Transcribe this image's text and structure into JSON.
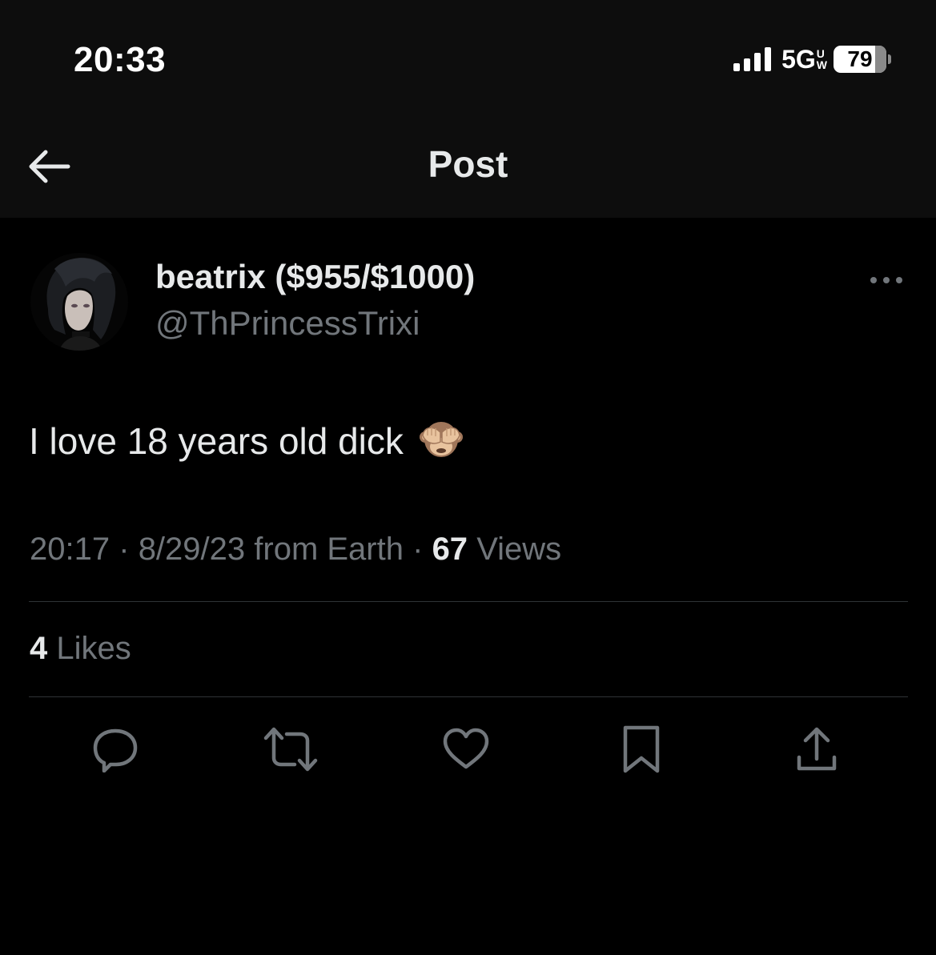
{
  "status_bar": {
    "time": "20:33",
    "network": "5G",
    "network_sub_top": "U",
    "network_sub_bottom": "W",
    "battery_level": "79",
    "battery_fraction": 0.79
  },
  "header": {
    "title": "Post",
    "back_icon": "arrow-left-icon"
  },
  "post": {
    "display_name": "beatrix ($955/$1000)",
    "handle": "@ThPrincessTrixi",
    "text": "I love 18 years old dick",
    "emoji": "see-no-evil-monkey-emoji",
    "time": "20:17",
    "separator": "·",
    "date_source": "8/29/23 from Earth",
    "views_count": "67",
    "views_label": "Views",
    "likes_count": "4",
    "likes_label": "Likes"
  },
  "actions": [
    {
      "name": "reply",
      "icon": "reply-icon"
    },
    {
      "name": "repost",
      "icon": "repost-icon"
    },
    {
      "name": "like",
      "icon": "heart-icon"
    },
    {
      "name": "bookmark",
      "icon": "bookmark-icon"
    },
    {
      "name": "share",
      "icon": "share-icon"
    }
  ],
  "colors": {
    "background": "#000000",
    "header_background": "#0d0d0d",
    "primary_text": "#e7e9ea",
    "secondary_text": "#71767b",
    "divider": "#2f3336"
  }
}
